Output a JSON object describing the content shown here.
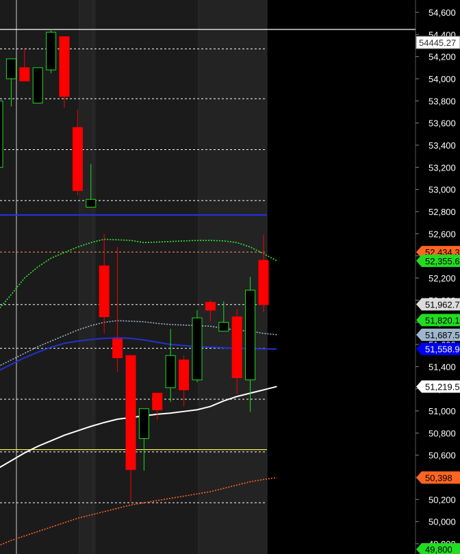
{
  "chart_data": {
    "type": "candlestick",
    "title": "",
    "xlabel": "",
    "ylabel": "",
    "ylim": [
      49800,
      54650
    ],
    "y_ticks": [
      "54,600",
      "54,400",
      "54,200",
      "54,000",
      "53,800",
      "53,600",
      "53,400",
      "53,200",
      "53,000",
      "52,800",
      "52,600",
      "52,400",
      "52,200",
      "52,000",
      "51,800",
      "51,600",
      "51,400",
      "51,200",
      "51,000",
      "50,800",
      "50,600",
      "50,400",
      "50,200",
      "50,000",
      "49,800"
    ],
    "y_tick_values": [
      54600,
      54400,
      54200,
      54000,
      53800,
      53600,
      53400,
      53200,
      53000,
      52800,
      52600,
      52400,
      52200,
      52000,
      51800,
      51600,
      51400,
      51200,
      51000,
      50800,
      50600,
      50400,
      50200,
      50000,
      49800
    ],
    "grid": true,
    "candles": [
      {
        "open": 53200,
        "high": 53850,
        "low": 53150,
        "close": 53800
      },
      {
        "open": 54000,
        "high": 54180,
        "low": 53750,
        "close": 54180
      },
      {
        "open": 54100,
        "high": 54280,
        "low": 53980,
        "close": 53980
      },
      {
        "open": 53780,
        "high": 54100,
        "low": 53780,
        "close": 54100
      },
      {
        "open": 54080,
        "high": 54450,
        "low": 54050,
        "close": 54420
      },
      {
        "open": 54380,
        "high": 54380,
        "low": 53740,
        "close": 53840
      },
      {
        "open": 53560,
        "high": 53720,
        "low": 52950,
        "close": 52990
      },
      {
        "open": 52840,
        "high": 53230,
        "low": 52840,
        "close": 52910
      },
      {
        "open": 52310,
        "high": 52600,
        "low": 51700,
        "close": 51850
      },
      {
        "open": 51650,
        "high": 52480,
        "low": 51350,
        "close": 51480
      },
      {
        "open": 51500,
        "high": 51500,
        "low": 50180,
        "close": 50470
      },
      {
        "open": 50750,
        "high": 50970,
        "low": 50460,
        "close": 51020
      },
      {
        "open": 51160,
        "high": 51160,
        "low": 50920,
        "close": 51010
      },
      {
        "open": 51210,
        "high": 51740,
        "low": 51080,
        "close": 51500
      },
      {
        "open": 51460,
        "high": 51500,
        "low": 51040,
        "close": 51190
      },
      {
        "open": 51280,
        "high": 51910,
        "low": 51260,
        "close": 51840
      },
      {
        "open": 51980,
        "high": 52000,
        "low": 51810,
        "close": 51910
      },
      {
        "open": 51720,
        "high": 51990,
        "low": 51720,
        "close": 51800
      },
      {
        "open": 51850,
        "high": 51920,
        "low": 51150,
        "close": 51300
      },
      {
        "open": 51280,
        "high": 52210,
        "low": 50990,
        "close": 52090
      },
      {
        "open": 52360,
        "high": 52590,
        "low": 51890,
        "close": 51960
      }
    ],
    "series": [
      {
        "type": "line",
        "color": "#33ee33",
        "style": "dotted",
        "values": [
          51910,
          52050,
          52200,
          52300,
          52380,
          52430,
          52480,
          52520,
          52550,
          52545,
          52540,
          52520,
          52525,
          52530,
          52535,
          52540,
          52540,
          52535,
          52520,
          52480,
          52420,
          52356
        ]
      },
      {
        "type": "line",
        "color": "#9fb6cc",
        "style": "dotted",
        "values": [
          51400,
          51460,
          51520,
          51580,
          51630,
          51680,
          51730,
          51770,
          51800,
          51815,
          51810,
          51805,
          51790,
          51780,
          51775,
          51770,
          51765,
          51745,
          51730,
          51720,
          51700,
          51688
        ]
      },
      {
        "type": "line",
        "color": "#2233cc",
        "style": "solid",
        "values": [
          51360,
          51420,
          51480,
          51530,
          51575,
          51610,
          51630,
          51645,
          51655,
          51660,
          51655,
          51640,
          51620,
          51600,
          51590,
          51580,
          51575,
          51570,
          51565,
          51563,
          51560,
          51559
        ]
      },
      {
        "type": "line",
        "color": "#ffffff",
        "style": "solid",
        "values": [
          50480,
          50550,
          50620,
          50680,
          50730,
          50780,
          50820,
          50860,
          50895,
          50925,
          50940,
          50955,
          50970,
          50980,
          50995,
          51010,
          51040,
          51090,
          51130,
          51160,
          51190,
          51220
        ]
      },
      {
        "type": "line",
        "color": "#ff6622",
        "style": "dotted",
        "values": [
          49780,
          49830,
          49870,
          49910,
          49950,
          49990,
          50030,
          50060,
          50090,
          50120,
          50150,
          50170,
          50190,
          50210,
          50230,
          50250,
          50270,
          50300,
          50330,
          50360,
          50380,
          50398
        ]
      }
    ],
    "hlines": [
      {
        "value": 54445.27,
        "color": "#ffffff",
        "style": "solid",
        "label": "54445.27"
      },
      {
        "value": 54270,
        "color": "#ffffff",
        "style": "dashed"
      },
      {
        "value": 53820,
        "color": "#ffffff",
        "style": "dashed"
      },
      {
        "value": 53360,
        "color": "#ffffff",
        "style": "dashed"
      },
      {
        "value": 52900,
        "color": "#ffffff",
        "style": "dashed"
      },
      {
        "value": 52770,
        "color": "#2233ee",
        "style": "solid"
      },
      {
        "value": 52434,
        "color": "#ff9966",
        "style": "dashed"
      },
      {
        "value": 51960,
        "color": "#ffffff",
        "style": "dashed"
      },
      {
        "value": 51565,
        "color": "#ffffff",
        "style": "dashed"
      },
      {
        "value": 51105,
        "color": "#ffffff",
        "style": "dashed"
      },
      {
        "value": 50650,
        "color": "#ffff44",
        "style": "solid"
      },
      {
        "value": 50630,
        "color": "#ffffff",
        "style": "dashed"
      },
      {
        "value": 50170,
        "color": "#ffffff",
        "style": "dashed"
      }
    ],
    "levels": [
      {
        "label": "52,434.3",
        "value": 52434.3,
        "bg": "#ff6622",
        "fg": "#000000"
      },
      {
        "label": "52,355.6",
        "value": 52355.6,
        "bg": "#22dd22",
        "fg": "#000000"
      },
      {
        "label": "51,962.7",
        "value": 51962.7,
        "bg": "#dddddd",
        "fg": "#000000"
      },
      {
        "label": "51,820.1",
        "value": 51820.1,
        "bg": "#22dd22",
        "fg": "#000000"
      },
      {
        "label": "51,687.5",
        "value": 51687.5,
        "bg": "#9fb6cc",
        "fg": "#000000"
      },
      {
        "label": "51,558.9",
        "value": 51558.9,
        "bg": "#0000ee",
        "fg": "#ffffff"
      },
      {
        "label": "51,219.5",
        "value": 51219.5,
        "bg": "#ffffff",
        "fg": "#000000"
      },
      {
        "label": "50,398",
        "value": 50398,
        "bg": "#ff6622",
        "fg": "#000000"
      },
      {
        "label": "49,800",
        "value": 49750,
        "bg": "#22dd22",
        "fg": "#000000"
      }
    ],
    "colors": {
      "background": "#1b1b1b",
      "band": "#232323",
      "axis_bg": "#000000",
      "bull": "#22dd22",
      "bear": "#ff0000",
      "grid": "#2e2e2e",
      "text": "#ffffff"
    }
  }
}
